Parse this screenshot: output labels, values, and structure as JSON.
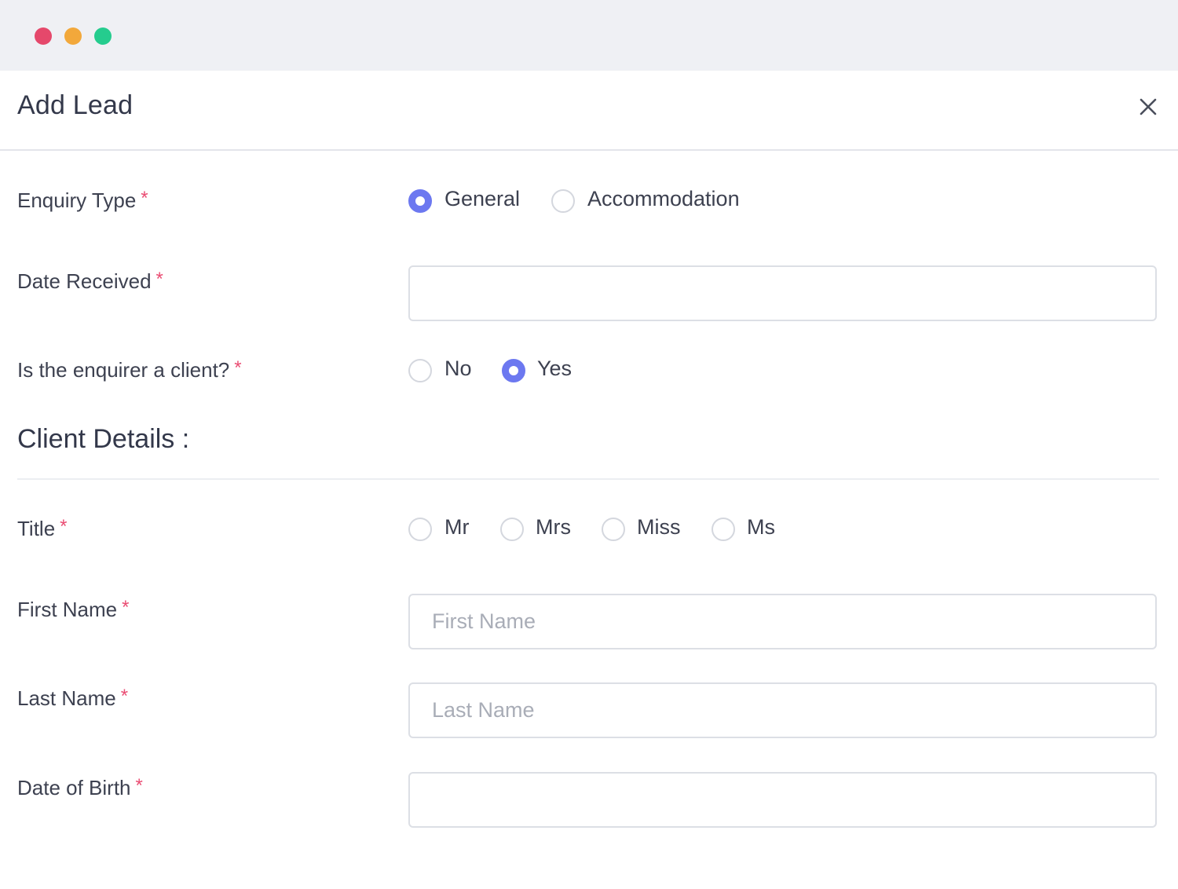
{
  "modal": {
    "title": "Add Lead"
  },
  "fields": {
    "enquiry_type": {
      "label": "Enquiry Type",
      "required": "*",
      "options": [
        "General",
        "Accommodation"
      ],
      "selected": "General"
    },
    "date_received": {
      "label": "Date Received",
      "required": "*",
      "value": "",
      "placeholder": ""
    },
    "is_client": {
      "label": "Is the enquirer a client?",
      "required": "*",
      "options": [
        "No",
        "Yes"
      ],
      "selected": "Yes"
    }
  },
  "client_details": {
    "heading": "Client Details :",
    "title_field": {
      "label": "Title",
      "required": "*",
      "options": [
        "Mr",
        "Mrs",
        "Miss",
        "Ms"
      ],
      "selected": ""
    },
    "first_name": {
      "label": "First Name",
      "required": "*",
      "value": "",
      "placeholder": "First Name"
    },
    "last_name": {
      "label": "Last Name",
      "required": "*",
      "value": "",
      "placeholder": "Last Name"
    },
    "date_of_birth": {
      "label": "Date of Birth",
      "required": "*",
      "value": "",
      "placeholder": ""
    }
  },
  "colors": {
    "accent": "#6c78f0",
    "required": "#ea4d73",
    "window_red": "#e5486b",
    "window_yellow": "#f2a83b",
    "window_green": "#25cc8e"
  },
  "icons": {
    "close": "close-icon"
  }
}
